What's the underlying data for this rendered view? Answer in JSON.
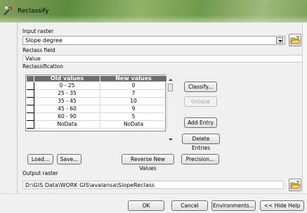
{
  "window": {
    "title": "Reclassify"
  },
  "input_raster": {
    "label": "Input raster",
    "value": "Slope degree"
  },
  "reclass_field": {
    "label": "Reclass field",
    "value": "Value"
  },
  "reclassification": {
    "label": "Reclassification",
    "columns": [
      "Old values",
      "New values"
    ],
    "rows": [
      {
        "old": "0 - 25",
        "new": "0"
      },
      {
        "old": "25 - 35",
        "new": "7"
      },
      {
        "old": "35 - 45",
        "new": "10"
      },
      {
        "old": "45 - 60",
        "new": "9"
      },
      {
        "old": "60 - 90",
        "new": "5"
      },
      {
        "old": "NoData",
        "new": "NoData"
      }
    ],
    "buttons": {
      "classify": "Classify...",
      "unique": "Unique",
      "add_entry": "Add Entry",
      "delete_entries": "Delete Entries",
      "load": "Load...",
      "save": "Save...",
      "reverse": "Reverse New Values",
      "precision": "Precision..."
    }
  },
  "output_raster": {
    "label": "Output raster",
    "value": "D:\\GIS Data\\WORK GIS\\avalansa\\SlopeReclass"
  },
  "footer": {
    "ok": "OK",
    "cancel": "Cancel",
    "environments": "Environments...",
    "hide_help": "<< Hide Help"
  },
  "colors": {
    "title_bar": "#6f9a4c",
    "grid_header": "#6d6d6d"
  },
  "icons": [
    "reclassify-app-icon",
    "open-folder-icon"
  ]
}
